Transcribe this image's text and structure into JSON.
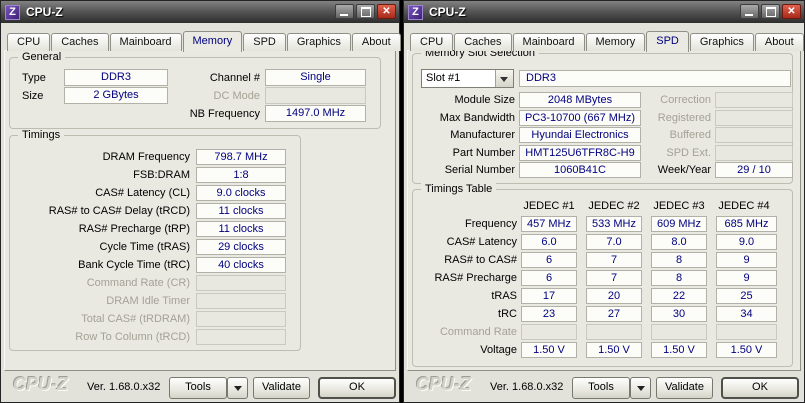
{
  "icons": {
    "app_letter": "Z",
    "close_glyph": "✕"
  },
  "colors": {
    "value_text": "#00007f",
    "titlebar_icon_bg": "#552e91",
    "close_button": "#b02818"
  },
  "left": {
    "title": "CPU-Z",
    "tabs": [
      {
        "label": "CPU",
        "name": "tab-cpu"
      },
      {
        "label": "Caches",
        "name": "tab-caches"
      },
      {
        "label": "Mainboard",
        "name": "tab-mainboard"
      },
      {
        "label": "Memory",
        "name": "tab-memory",
        "state": "active"
      },
      {
        "label": "SPD",
        "name": "tab-spd"
      },
      {
        "label": "Graphics",
        "name": "tab-graphics"
      },
      {
        "label": "About",
        "name": "tab-about"
      }
    ],
    "general": {
      "legend": "General",
      "type_label": "Type",
      "type_value": "DDR3",
      "size_label": "Size",
      "size_value": "2 GBytes",
      "channel_label": "Channel #",
      "channel_value": "Single",
      "dc_label": "DC Mode",
      "dc_value": "",
      "nb_label": "NB Frequency",
      "nb_value": "1497.0 MHz"
    },
    "timings": {
      "legend": "Timings",
      "rows": [
        {
          "label": "DRAM Frequency",
          "value": "798.7 MHz"
        },
        {
          "label": "FSB:DRAM",
          "value": "1:8"
        },
        {
          "label": "CAS# Latency (CL)",
          "value": "9.0 clocks"
        },
        {
          "label": "RAS# to CAS# Delay (tRCD)",
          "value": "11 clocks"
        },
        {
          "label": "RAS# Precharge (tRP)",
          "value": "11 clocks"
        },
        {
          "label": "Cycle Time (tRAS)",
          "value": "29 clocks"
        },
        {
          "label": "Bank Cycle Time (tRC)",
          "value": "40 clocks"
        },
        {
          "label": "Command Rate (CR)",
          "value": "",
          "state": "disabled"
        },
        {
          "label": "DRAM Idle Timer",
          "value": "",
          "state": "disabled"
        },
        {
          "label": "Total CAS# (tRDRAM)",
          "value": "",
          "state": "disabled"
        },
        {
          "label": "Row To Column (tRCD)",
          "value": "",
          "state": "disabled"
        }
      ]
    },
    "footer": {
      "logo": "CPU-Z",
      "version": "Ver. 1.68.0.x32",
      "tools": "Tools",
      "validate": "Validate",
      "ok": "OK"
    }
  },
  "right": {
    "title": "CPU-Z",
    "tabs": [
      {
        "label": "CPU",
        "name": "tab-cpu"
      },
      {
        "label": "Caches",
        "name": "tab-caches"
      },
      {
        "label": "Mainboard",
        "name": "tab-mainboard"
      },
      {
        "label": "Memory",
        "name": "tab-memory"
      },
      {
        "label": "SPD",
        "name": "tab-spd",
        "state": "active"
      },
      {
        "label": "Graphics",
        "name": "tab-graphics"
      },
      {
        "label": "About",
        "name": "tab-about"
      }
    ],
    "slot": {
      "legend": "Memory Slot Selection",
      "slot_value": "Slot #1",
      "type_value": "DDR3",
      "left_rows": [
        {
          "label": "Module Size",
          "value": "2048 MBytes"
        },
        {
          "label": "Max Bandwidth",
          "value": "PC3-10700 (667 MHz)"
        },
        {
          "label": "Manufacturer",
          "value": "Hyundai Electronics"
        },
        {
          "label": "Part Number",
          "value": "HMT125U6TFR8C-H9"
        },
        {
          "label": "Serial Number",
          "value": "1060B41C"
        }
      ],
      "right_rows": [
        {
          "label": "Correction",
          "value": "",
          "state": "disabled"
        },
        {
          "label": "Registered",
          "value": "",
          "state": "disabled"
        },
        {
          "label": "Buffered",
          "value": "",
          "state": "disabled"
        },
        {
          "label": "SPD Ext.",
          "value": "",
          "state": "disabled"
        },
        {
          "label": "Week/Year",
          "value": "29 / 10"
        }
      ]
    },
    "timings_table": {
      "legend": "Timings Table",
      "columns": [
        "JEDEC #1",
        "JEDEC #2",
        "JEDEC #3",
        "JEDEC #4"
      ],
      "rows": [
        {
          "label": "Frequency",
          "values": [
            "457 MHz",
            "533 MHz",
            "609 MHz",
            "685 MHz"
          ]
        },
        {
          "label": "CAS# Latency",
          "values": [
            "6.0",
            "7.0",
            "8.0",
            "9.0"
          ]
        },
        {
          "label": "RAS# to CAS#",
          "values": [
            "6",
            "7",
            "8",
            "9"
          ]
        },
        {
          "label": "RAS# Precharge",
          "values": [
            "6",
            "7",
            "8",
            "9"
          ]
        },
        {
          "label": "tRAS",
          "values": [
            "17",
            "20",
            "22",
            "25"
          ]
        },
        {
          "label": "tRC",
          "values": [
            "23",
            "27",
            "30",
            "34"
          ]
        },
        {
          "label": "Command Rate",
          "values": [
            "",
            "",
            "",
            ""
          ],
          "state": "disabled"
        },
        {
          "label": "Voltage",
          "values": [
            "1.50 V",
            "1.50 V",
            "1.50 V",
            "1.50 V"
          ]
        }
      ]
    },
    "footer": {
      "logo": "CPU-Z",
      "version": "Ver. 1.68.0.x32",
      "tools": "Tools",
      "validate": "Validate",
      "ok": "OK"
    }
  }
}
